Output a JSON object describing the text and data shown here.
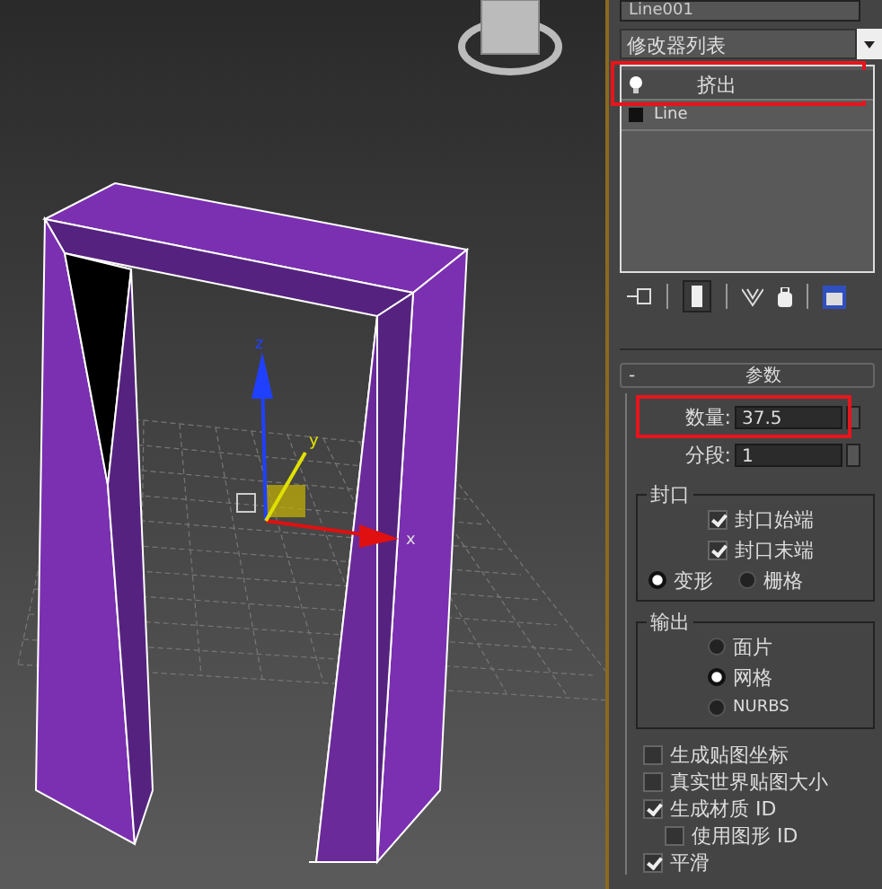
{
  "viewport": {
    "axis_labels": [
      "z",
      "y",
      "x"
    ]
  },
  "object_name": "Line001",
  "modifier_list": {
    "value": "修改器列表"
  },
  "stack": [
    {
      "label": "挤出",
      "kind": "modifier",
      "selected": true,
      "highlighted": true
    },
    {
      "label": "Line",
      "kind": "base",
      "selected": false,
      "highlighted": false
    }
  ],
  "rollout": {
    "toggle": "-",
    "title": "参数"
  },
  "amount": {
    "label": "数量:",
    "value": "37.5",
    "highlighted": true
  },
  "segments": {
    "label": "分段:",
    "value": "1",
    "highlighted": false
  },
  "capping": {
    "title": "封口",
    "options": [
      {
        "label": "封口始端",
        "checked": true
      },
      {
        "label": "封口末端",
        "checked": true
      }
    ],
    "types": [
      {
        "label": "变形",
        "selected": true
      },
      {
        "label": "栅格",
        "selected": false
      }
    ]
  },
  "output": {
    "title": "输出",
    "options": [
      {
        "label": "面片",
        "selected": false
      },
      {
        "label": "网格",
        "selected": true
      },
      {
        "label": "NURBS",
        "selected": false
      }
    ]
  },
  "flags": [
    {
      "label": "生成贴图坐标",
      "checked": false
    },
    {
      "label": "真实世界贴图大小",
      "checked": false
    },
    {
      "label": "生成材质 ID",
      "checked": true,
      "children": [
        {
          "label": "使用图形 ID",
          "checked": false
        }
      ]
    },
    {
      "label": "平滑",
      "checked": true
    }
  ]
}
